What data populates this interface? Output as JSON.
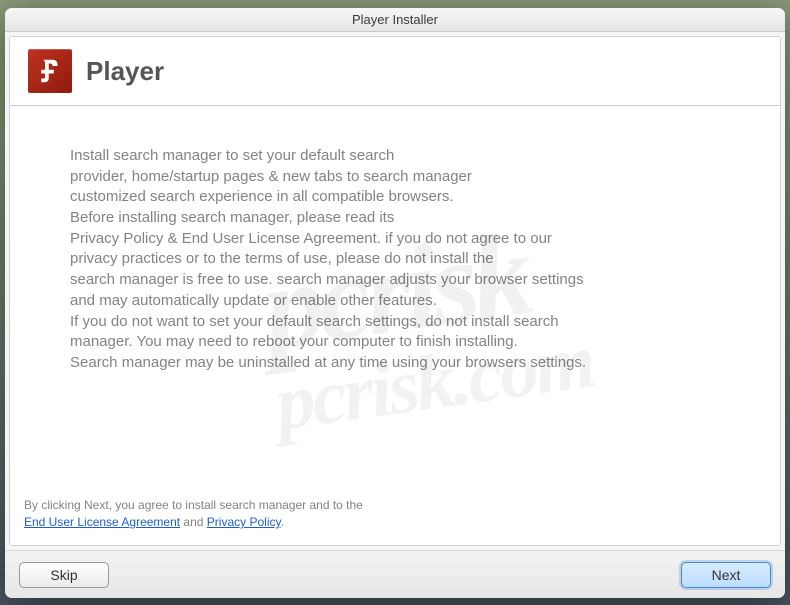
{
  "titlebar": {
    "title": "Player Installer"
  },
  "header": {
    "app_name": "Player"
  },
  "body": {
    "line1": "Install search manager to set your default search",
    "line2": "provider, home/startup pages & new tabs to search manager",
    "line3": "customized search experience in all compatible browsers.",
    "line4": "Before installing search manager, please read its",
    "line5": "Privacy Policy & End User License Agreement. if you do not agree to our",
    "line6": "privacy practices or to the terms of use, please do not install the",
    "line7": "search manager is free to use. search manager adjusts your browser settings",
    "line8": "and may automatically update or enable other features.",
    "line9": "If you do not want to set your default search settings, do not install search",
    "line10": "manager. You may need to reboot your computer to finish installing.",
    "line11": "Search manager may be uninstalled at any time using your browsers settings."
  },
  "agreement": {
    "line1": "By clicking Next, you agree to install search manager and to the",
    "eula_label": "End User License Agreement",
    "and": " and ",
    "privacy_label": "Privacy Policy",
    "period": "."
  },
  "footer": {
    "skip_label": "Skip",
    "next_label": "Next"
  },
  "watermark": {
    "main": "pcrisk",
    "sub": "pcrisk.com"
  }
}
